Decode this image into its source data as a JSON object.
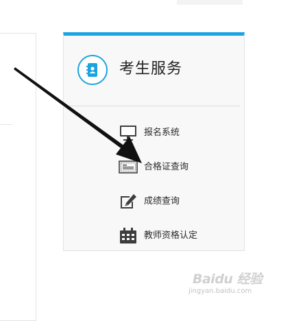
{
  "service_card": {
    "title": "考生服务",
    "title_icon": "address-book-icon",
    "accent_color": "#1aa3e0",
    "items": [
      {
        "label": "报名系统",
        "icon": "monitor-icon"
      },
      {
        "label": "合格证查询",
        "icon": "certificate-icon"
      },
      {
        "label": "成绩查询",
        "icon": "edit-icon"
      },
      {
        "label": "教师资格认定",
        "icon": "calendar-icon"
      }
    ]
  },
  "annotation": {
    "type": "arrow",
    "color": "#111111"
  },
  "watermark": {
    "logo": "Baidu 经验",
    "text": "jingyan.baidu.com"
  }
}
